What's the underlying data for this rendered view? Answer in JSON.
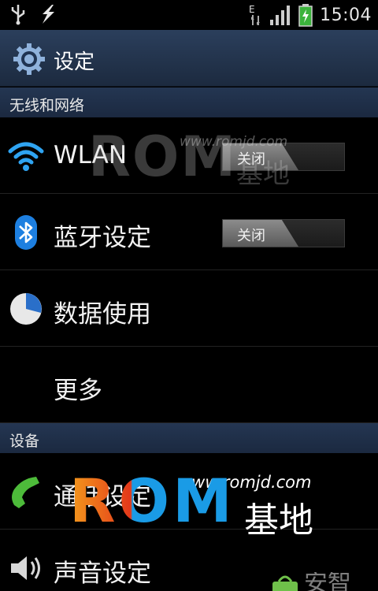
{
  "status_bar": {
    "time": "15:04",
    "network_type": "E",
    "icons": [
      "usb-icon",
      "usb-debug-icon",
      "data-arrows-icon",
      "signal-icon",
      "battery-charging-icon"
    ]
  },
  "title_bar": {
    "title": "设定",
    "icon": "gear-icon"
  },
  "sections": [
    {
      "header": "无线和网络",
      "items": [
        {
          "label": "WLAN",
          "icon": "wifi-icon",
          "toggle": "关闭"
        },
        {
          "label": "蓝牙设定",
          "icon": "bluetooth-icon",
          "toggle": "关闭"
        },
        {
          "label": "数据使用",
          "icon": "data-usage-pie-icon"
        },
        {
          "label": "更多",
          "icon": ""
        }
      ]
    },
    {
      "header": "设备",
      "items": [
        {
          "label": "通话设定",
          "icon": "phone-handset-icon"
        },
        {
          "label": "声音设定",
          "icon": "speaker-icon"
        }
      ]
    }
  ],
  "watermarks": {
    "faint_url": "www.romjd.com",
    "faint_brand": "ROM",
    "faint_cn": "基地",
    "main_url": "www.romjd.com",
    "main_brand": "ROM",
    "main_cn": "基地",
    "corner_text": "安智"
  },
  "colors": {
    "section_header": "#1f2f48",
    "title_bar": "#24354f",
    "logo_orange": "#f39a1c",
    "logo_red": "#e43a1a",
    "logo_blue": "#1a9be6",
    "wifi_blue": "#2fa4f2"
  }
}
